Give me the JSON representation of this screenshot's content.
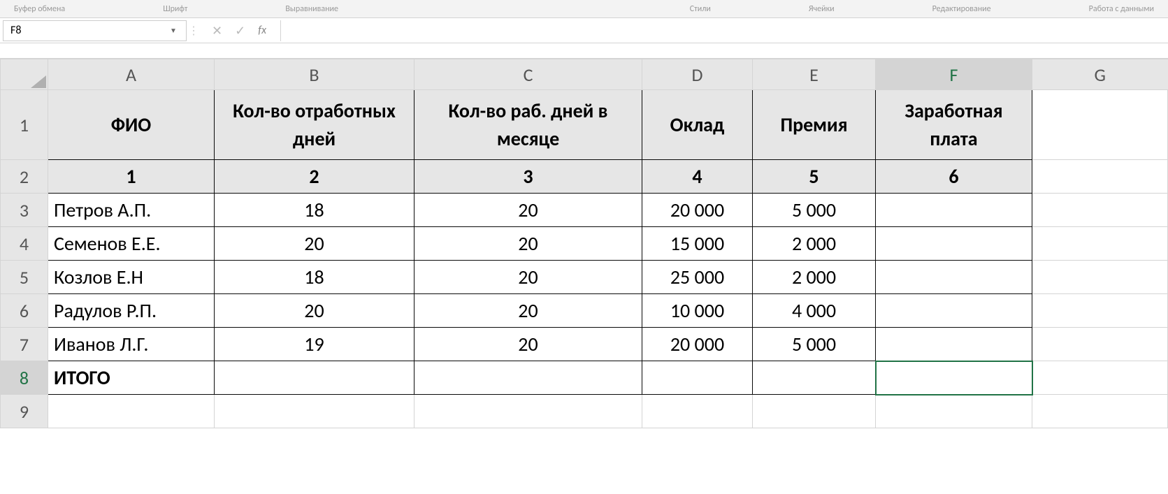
{
  "ribbon": {
    "group1": "Буфер обмена",
    "group2": "Шрифт",
    "group3": "Выравнивание",
    "group5": "Стили",
    "group6": "Ячейки",
    "group7": "Редактирование",
    "group8": "Работа с данными"
  },
  "nameBox": {
    "value": "F8"
  },
  "formulaBar": {
    "cancel": "✕",
    "confirm": "✓",
    "fx": "fx",
    "value": ""
  },
  "columns": {
    "A": "A",
    "B": "B",
    "C": "C",
    "D": "D",
    "E": "E",
    "F": "F",
    "G": "G"
  },
  "rowLabels": {
    "1": "1",
    "2": "2",
    "3": "3",
    "4": "4",
    "5": "5",
    "6": "6",
    "7": "7",
    "8": "8",
    "9": "9"
  },
  "headers": {
    "A": "ФИО",
    "B": "Кол-во отработных дней",
    "C": "Кол-во раб. дней в месяце",
    "D": "Оклад",
    "E": "Премия",
    "F": "Заработная плата"
  },
  "numberRow": {
    "A": "1",
    "B": "2",
    "C": "3",
    "D": "4",
    "E": "5",
    "F": "6"
  },
  "rows": [
    {
      "name": "Петров А.П.",
      "workedDays": "18",
      "workDaysMonth": "20",
      "salary": "20 000",
      "bonus": "5 000",
      "wage": ""
    },
    {
      "name": "Семенов Е.Е.",
      "workedDays": "20",
      "workDaysMonth": "20",
      "salary": "15 000",
      "bonus": "2 000",
      "wage": ""
    },
    {
      "name": "Козлов Е.Н",
      "workedDays": "18",
      "workDaysMonth": "20",
      "salary": "25 000",
      "bonus": "2 000",
      "wage": ""
    },
    {
      "name": "Радулов Р.П.",
      "workedDays": "20",
      "workDaysMonth": "20",
      "salary": "10 000",
      "bonus": "4 000",
      "wage": ""
    },
    {
      "name": "Иванов Л.Г.",
      "workedDays": "19",
      "workDaysMonth": "20",
      "salary": "20 000",
      "bonus": "5 000",
      "wage": ""
    }
  ],
  "totals": {
    "label": "ИТОГО",
    "B": "",
    "C": "",
    "D": "",
    "E": "",
    "F": ""
  },
  "chart_data": {
    "type": "table",
    "title": "Заработная плата",
    "columns": [
      "ФИО",
      "Кол-во отработных дней",
      "Кол-во раб. дней в месяце",
      "Оклад",
      "Премия",
      "Заработная плата"
    ],
    "rows": [
      [
        "Петров А.П.",
        18,
        20,
        20000,
        5000,
        null
      ],
      [
        "Семенов Е.Е.",
        20,
        20,
        15000,
        2000,
        null
      ],
      [
        "Козлов Е.Н",
        18,
        20,
        25000,
        2000,
        null
      ],
      [
        "Радулов Р.П.",
        20,
        20,
        10000,
        4000,
        null
      ],
      [
        "Иванов Л.Г.",
        19,
        20,
        20000,
        5000,
        null
      ]
    ],
    "totals_row": [
      "ИТОГО",
      null,
      null,
      null,
      null,
      null
    ]
  }
}
